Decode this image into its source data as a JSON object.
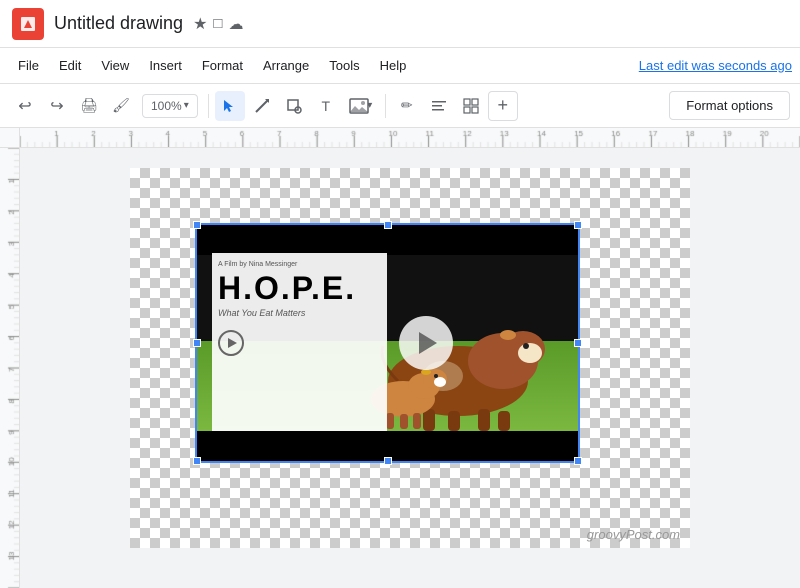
{
  "titleBar": {
    "appName": "Untitled drawing",
    "starIcon": "★",
    "driveIcon": "⊡",
    "cloudIcon": "☁"
  },
  "menuBar": {
    "items": [
      "File",
      "Edit",
      "View",
      "Insert",
      "Format",
      "Arrange",
      "Tools",
      "Help"
    ],
    "lastEdit": "Last edit was seconds ago"
  },
  "toolbar": {
    "undoIcon": "↩",
    "redoIcon": "↪",
    "printIcon": "⎙",
    "paintIcon": "🖌",
    "zoomLabel": "100%",
    "zoomDropIcon": "▾",
    "selectIcon": "↖",
    "lineIcon": "╲",
    "shapeIcon": "○",
    "textboxIcon": "⊞",
    "imageIcon": "⬜",
    "penIcon": "✏",
    "alignIcon": "≡",
    "tableIcon": "⊞",
    "plusIcon": "+",
    "formatOptionsLabel": "Format options"
  },
  "canvas": {
    "videoTitle": "H.O.P.E.",
    "filmBy": "A Film by Nina Messinger",
    "subtitle": "What You Eat Matters"
  },
  "watermark": "groovyPost.com"
}
